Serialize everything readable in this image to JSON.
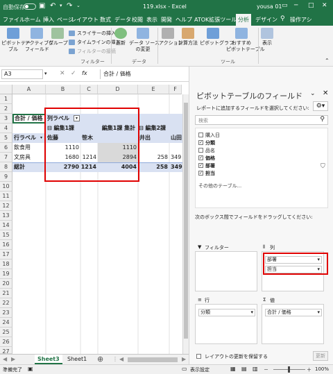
{
  "titlebar": {
    "autosave": "自動保存",
    "autosave_state": "オフ",
    "filename": "119.xlsx - Excel",
    "user": "yousa 01"
  },
  "tabs": [
    "ファイル",
    "ホーム",
    "挿入",
    "ページ",
    "レイアウト",
    "数式",
    "データ",
    "校閲",
    "表示",
    "開発",
    "ヘルプ",
    "ATOK拡張ツール",
    "分析",
    "デザイン",
    "操作アシ"
  ],
  "ribbon": {
    "pivottable": [
      "ピボットテー",
      "ブル"
    ],
    "activefield": [
      "アクティブな",
      "フィールド"
    ],
    "group": "グループ",
    "slicer": "スライサーの挿入",
    "timeline": "タイムラインの挿入",
    "filterconn": "フィルターの接続",
    "filter_group": "フィルター",
    "refresh": "更新",
    "datasource": [
      "データ ソース",
      "の変更"
    ],
    "data_group": "データ",
    "action": "アクション",
    "calc": "計算方法",
    "pivotchart": "ピボットグラフ",
    "recommended": [
      "おすすめ",
      "ピボットテーブル"
    ],
    "tools_group": "ツール",
    "show": "表示"
  },
  "formula": {
    "namebox": "A3",
    "fx": "fx",
    "value": "合計 / 価格"
  },
  "columns": [
    "A",
    "B",
    "C",
    "D",
    "E",
    "F"
  ],
  "rows": [
    "1",
    "2",
    "3",
    "4",
    "5",
    "6",
    "7",
    "8",
    "9",
    "10",
    "11",
    "12",
    "13",
    "14",
    "15",
    "16",
    "17",
    "18",
    "19",
    "20",
    "21",
    "22",
    "23",
    "24",
    "25",
    "26",
    "27"
  ],
  "pivot": {
    "a3": "合計 / 価格",
    "b3": "列ラベル",
    "b4": "⊟ 編集1課",
    "d4": "編集1課 集計",
    "e4": "⊟ 編集2課",
    "a5": "行ラベル",
    "b5": "佐藤",
    "c5": "笹木",
    "e5": "井出",
    "f5": "山田",
    "a6": "飲食用",
    "b6": "1110",
    "d6": "1110",
    "a7": "文房具",
    "b7": "1680",
    "c7": "1214",
    "d7": "2894",
    "e7": "258",
    "f7": "349",
    "a8": "総計",
    "b8": "2790",
    "c8": "1214",
    "d8": "4004",
    "e8": "258",
    "f8": "349"
  },
  "sheets": {
    "tabs": [
      "Sheet3",
      "Sheet1"
    ],
    "add": "⊕"
  },
  "status": {
    "ready": "準備完了",
    "display": "表示設定",
    "zoom": "100%",
    "minus": "－",
    "plus": "＋"
  },
  "pane": {
    "title": "ピボットテーブルのフィールド",
    "subtitle": "レポートに追加するフィールドを選択してください:",
    "search_placeholder": "検索",
    "fields": [
      {
        "name": "購入日",
        "checked": false
      },
      {
        "name": "分類",
        "checked": true
      },
      {
        "name": "品名",
        "checked": false
      },
      {
        "name": "価格",
        "checked": true
      },
      {
        "name": "部署",
        "checked": true
      },
      {
        "name": "担当",
        "checked": true
      }
    ],
    "more_tables": "その他のテーブル...",
    "drag_hint": "次のボックス間でフィールドをドラッグしてください:",
    "filter_label": "フィルター",
    "columns_label": "列",
    "rows_label": "行",
    "values_label": "値",
    "columns_items": [
      "部署",
      "担当"
    ],
    "rows_items": [
      "分類"
    ],
    "values_items": [
      "合計 / 価格"
    ],
    "defer": "レイアウトの更新を保留する",
    "update": "更新"
  }
}
